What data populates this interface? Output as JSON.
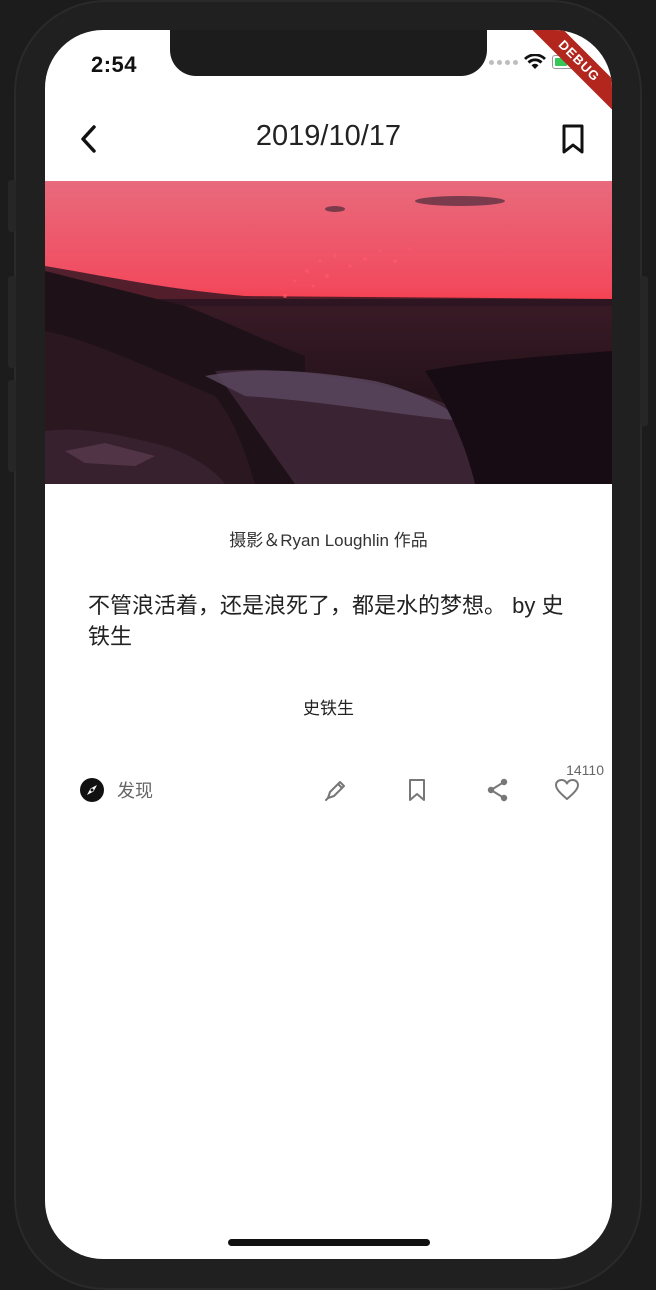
{
  "status_bar": {
    "time": "2:54",
    "debug_label": "DEBUG"
  },
  "header": {
    "title": "2019/10/17",
    "back_icon": "chevron-left-icon",
    "bookmark_icon": "bookmark-icon"
  },
  "hero_image": {
    "description_icon": "photo"
  },
  "content": {
    "caption": "摄影＆Ryan Loughlin 作品",
    "quote": "不管浪活着，还是浪死了，都是水的梦想。 by 史铁生",
    "author": "史铁生"
  },
  "actions": {
    "discover_label": "发现",
    "like_count": "14110",
    "icons": [
      "compass-icon",
      "pen-icon",
      "bookmark-icon",
      "share-icon",
      "heart-icon"
    ]
  },
  "colors": {
    "accent": "#b3261e",
    "text_primary": "#222222",
    "text_secondary": "#666666"
  }
}
